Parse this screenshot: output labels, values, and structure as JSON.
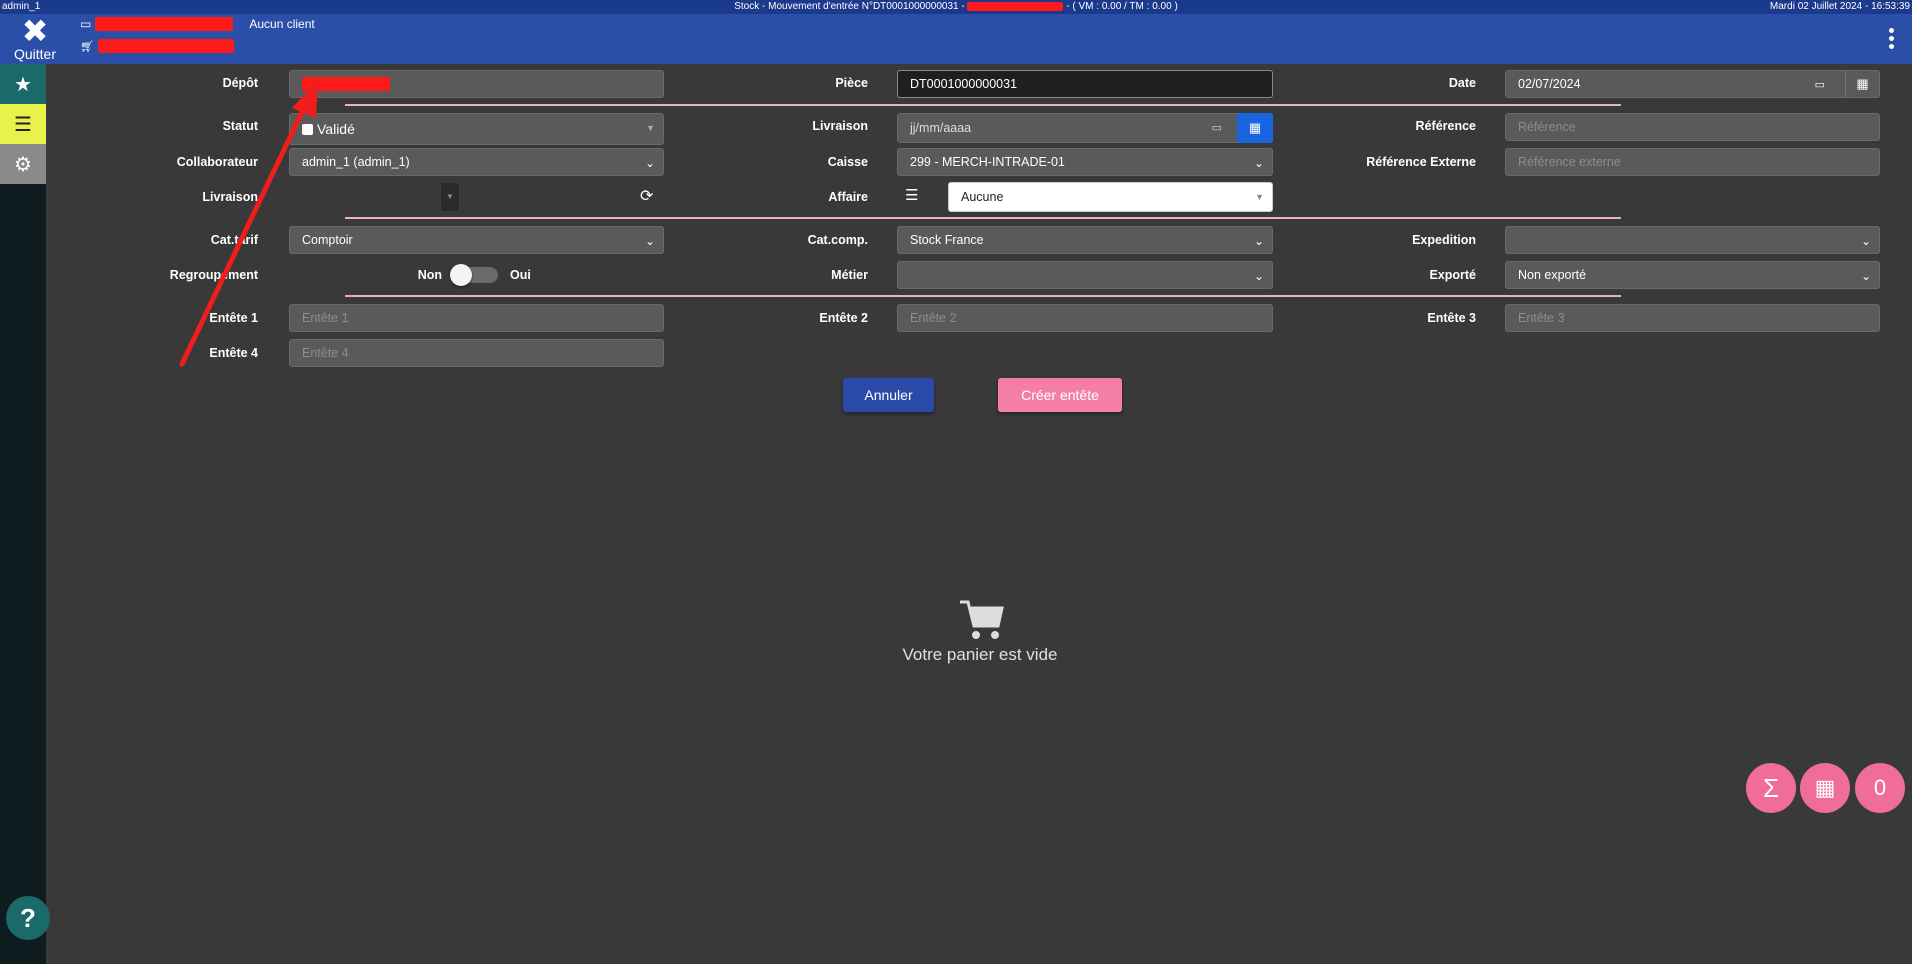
{
  "system_bar": {
    "user": "admin_1",
    "title_prefix": "Stock - Mouvement d'entrée N°DT0001000000031 - ",
    "title_suffix": " - ( VM : 0.00 / TM : 0.00 )",
    "datetime": "Mardi 02 Juillet 2024 - 16:53:39"
  },
  "header": {
    "quit_label": "Quitter",
    "client": "Aucun client"
  },
  "form": {
    "depot_label": "Dépôt",
    "piece_label": "Pièce",
    "piece_value": "DT0001000000031",
    "date_label": "Date",
    "date_value": "02/07/2024",
    "statut_label": "Statut",
    "statut_value": "Validé",
    "livraison_label": "Livraison",
    "livraison_date_placeholder": "jj/mm/aaaa",
    "reference_label": "Référence",
    "reference_placeholder": "Référence",
    "collaborateur_label": "Collaborateur",
    "collaborateur_value": "admin_1 (admin_1)",
    "caisse_label": "Caisse",
    "caisse_value": "299 - MERCH-INTRADE-01",
    "ref_externe_label": "Référence Externe",
    "ref_externe_placeholder": "Référence externe",
    "livraison2_label": "Livraison",
    "affaire_label": "Affaire",
    "affaire_value": "Aucune",
    "cattarif_label": "Cat.tarif",
    "cattarif_value": "Comptoir",
    "catcomp_label": "Cat.comp.",
    "catcomp_value": "Stock France",
    "expedition_label": "Expedition",
    "expedition_value": "",
    "regroupement_label": "Regroupement",
    "toggle_off": "Non",
    "toggle_on": "Oui",
    "metier_label": "Métier",
    "metier_value": "",
    "exporte_label": "Exporté",
    "exporte_value": "Non exporté",
    "entete1_label": "Entête 1",
    "entete1_placeholder": "Entête 1",
    "entete2_label": "Entête 2",
    "entete2_placeholder": "Entête 2",
    "entete3_label": "Entête 3",
    "entete3_placeholder": "Entête 3",
    "entete4_label": "Entête 4",
    "entete4_placeholder": "Entête 4"
  },
  "actions": {
    "cancel": "Annuler",
    "create": "Créer entête"
  },
  "cart": {
    "empty_text": "Votre panier est vide"
  },
  "fab": {
    "sum_symbol": "Σ",
    "count": "0"
  },
  "help_symbol": "?",
  "colors": {
    "header": "#2b4ea8",
    "accent_pink": "#f06c9b",
    "primary_blue": "#2a49a8",
    "sidebar_teal": "#1a6a6a",
    "sidebar_yellow": "#e8f24a"
  }
}
